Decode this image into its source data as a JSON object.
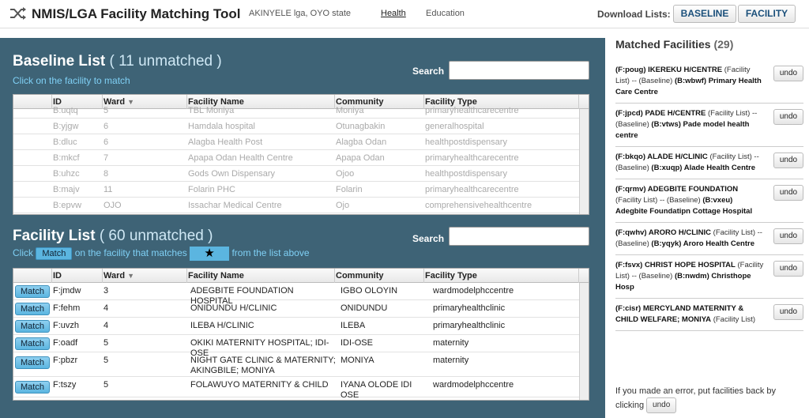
{
  "header": {
    "app_title": "NMIS/LGA Facility Matching Tool",
    "lga": "AKINYELE lga, OYO state",
    "nav": [
      "Health",
      "Education"
    ],
    "download_label": "Download Lists:",
    "baseline_btn": "BASELINE",
    "facility_btn": "FACILITY"
  },
  "baseline": {
    "title": "Baseline List",
    "count": "( 11 unmatched )",
    "subtitle": "Click on the facility to match",
    "search_label": "Search",
    "columns": [
      "ID",
      "Ward",
      "Facility Name",
      "Community",
      "Facility Type"
    ],
    "rows": [
      [
        "B:uqtq",
        "5",
        "TBL Moniya",
        "Moniya",
        "primaryhealthcarecentre"
      ],
      [
        "B:yjgw",
        "6",
        "Hamdala hospital",
        "Otunagbakin",
        "generalhospital"
      ],
      [
        "B:dluc",
        "6",
        "Alagba Health Post",
        "Alagba Odan",
        "healthpostdispensary"
      ],
      [
        "B:mkcf",
        "7",
        "Apapa Odan Health Centre",
        "Apapa Odan",
        "primaryhealthcarecentre"
      ],
      [
        "B:uhzc",
        "8",
        "Gods Own Dispensary",
        "Ojoo",
        "healthpostdispensary"
      ],
      [
        "B:majv",
        "11",
        "Folarin PHC",
        "Folarin",
        "primaryhealthcarecentre"
      ],
      [
        "B:epvw",
        "OJO",
        "Issachar Medical Centre",
        "Ojo",
        "comprehensivehealthcentre"
      ]
    ]
  },
  "facility": {
    "title": "Facility List",
    "count": "( 60 unmatched )",
    "instr_click": "Click",
    "instr_match": "Match",
    "instr_mid": "on the facility that matches",
    "instr_star": "★",
    "instr_end": "from the list above",
    "search_label": "Search",
    "match_label": "Match",
    "columns": [
      "ID",
      "Ward",
      "Facility Name",
      "Community",
      "Facility Type"
    ],
    "rows": [
      [
        "F:jmdw",
        "3",
        "ADEGBITE FOUNDATION HOSPITAL",
        "IGBO OLOYIN",
        "wardmodelphccentre"
      ],
      [
        "F:fehm",
        "4",
        "ONIDUNDU H/CLINIC",
        "ONIDUNDU",
        "primaryhealthclinic"
      ],
      [
        "F:uvzh",
        "4",
        "ILEBA H/CLINIC",
        "ILEBA",
        "primaryhealthclinic"
      ],
      [
        "F:oadf",
        "5",
        "OKIKI MATERNITY HOSPITAL; IDI-OSE",
        "IDI-OSE",
        "maternity"
      ],
      [
        "F:pbzr",
        "5",
        "NIGHT GATE CLINIC & MATERNITY; AKINGBILE; MONIYA",
        "MONIYA",
        "maternity"
      ],
      [
        "F:tszy",
        "5",
        "FOLAWUYO MATERNITY & CHILD",
        "IYANA OLODE IDI OSE",
        "wardmodelphccentre"
      ]
    ]
  },
  "matched": {
    "title": "Matched Facilities",
    "count": "(29)",
    "undo_label": "undo",
    "items": [
      {
        "f": "(F:poug) IKEREKU H/CENTRE",
        "mid": "(Facility List) -- (Baseline)",
        "b": "(B:wbwf) Primary Health Care Centre"
      },
      {
        "f": "(F:jpcd) PADE H/CENTRE",
        "mid": "(Facility List) -- (Baseline)",
        "b": "(B:vtws) Pade model health centre"
      },
      {
        "f": "(F:bkqo) ALADE H/CLINIC",
        "mid": "(Facility List) -- (Baseline)",
        "b": "(B:xuqp) Alade Health Centre"
      },
      {
        "f": "(F:qrmv) ADEGBITE FOUNDATION",
        "mid": "(Facility List) -- (Baseline)",
        "b": "(B:vxeu) Adegbite Foundatipn Cottage Hospital"
      },
      {
        "f": "(F:qwhv) ARORO H/CLINIC",
        "mid": "(Facility List) -- (Baseline)",
        "b": "(B:yqyk) Aroro Health Centre"
      },
      {
        "f": "(F:fsvx) CHRIST HOPE HOSPITAL",
        "mid": "(Facility List) -- (Baseline)",
        "b": "(B:nwdm) Christhope Hosp"
      },
      {
        "f": "(F:cisr) MERCYLAND MATERNITY & CHILD WELFARE; MONIYA",
        "mid": "(Facility List)",
        "b": ""
      }
    ],
    "footnote": "If you made an error, put facilities back by clicking",
    "footnote_undo": "undo"
  }
}
